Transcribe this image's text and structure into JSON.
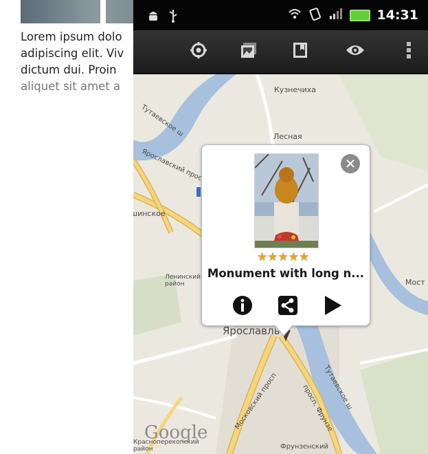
{
  "background": {
    "lorem_lines": [
      "Lorem ipsum dolo",
      "adipiscing elit. Viv",
      "dictum dui. Proin",
      "aliquet sit amet a"
    ]
  },
  "statusbar": {
    "time": "14:31",
    "left_icons": [
      "android-icon",
      "usb-icon"
    ],
    "right_icons": [
      "wifi-icon",
      "sync-icon",
      "signal-icon",
      "battery-icon"
    ]
  },
  "actionbar": {
    "icons": [
      "locate-icon",
      "gallery-icon",
      "bookmark-icon",
      "eye-icon",
      "overflow-menu-icon"
    ]
  },
  "map": {
    "labels": {
      "kuznechikha": "Кузнечиха",
      "lesnaya": "Лесная",
      "tutaevskoe": "Тутаевское ш",
      "prospekt": "Ярославский просп",
      "shinskoe": "шинское",
      "leninsky": "Ленинский район",
      "most": "Мост",
      "yaroslavl": "Ярославль",
      "moskovsky": "Московский просп",
      "frunzensky": "Фрунзенский",
      "krasnoperek": "Красноперекопский район",
      "tutaevskoe2": "Тутаевское ш",
      "frunze": "просп. Фрунзе"
    },
    "google_logo": "Google",
    "colors": {
      "water": "#a6c0de",
      "road_major": "#f6d57e",
      "road_outline": "#d9b554",
      "park": "#c7dcab"
    }
  },
  "popup": {
    "title": "Monument with long n...",
    "rating": 5,
    "close_label": "✕",
    "actions": [
      "info-icon",
      "share-icon",
      "play-icon"
    ]
  }
}
